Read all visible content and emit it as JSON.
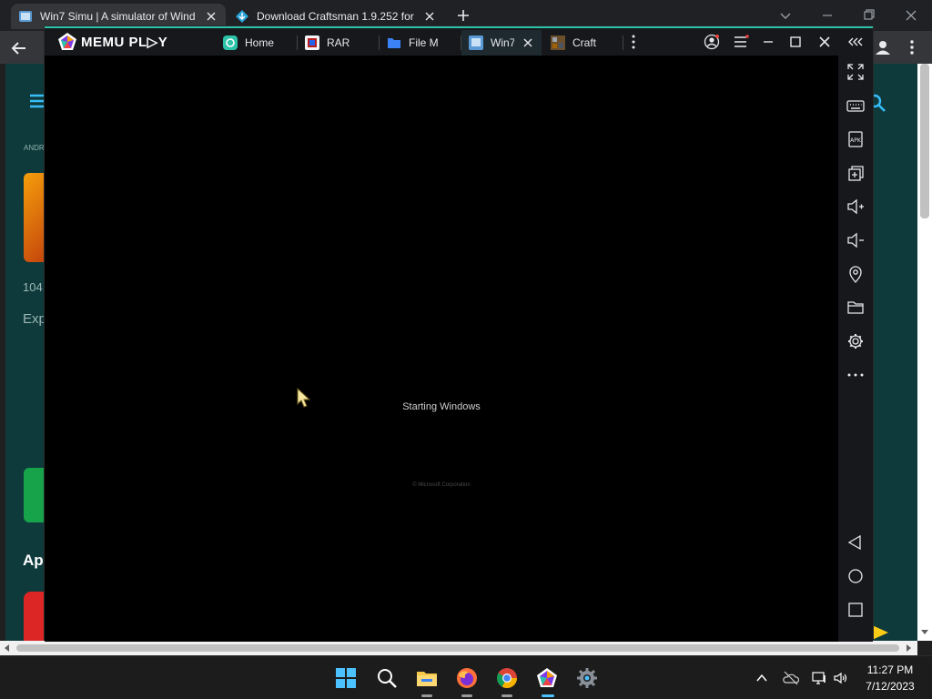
{
  "browser": {
    "tabs": [
      {
        "title": "Win7 Simu | A simulator of Wind",
        "active": true
      },
      {
        "title": "Download Craftsman 1.9.252 for",
        "active": false
      }
    ]
  },
  "website": {
    "breadcrumb": "ANDR",
    "stat": "104",
    "description": "Exp",
    "section_heading": "Ap"
  },
  "memu": {
    "logo_text": "MEMU PL▷Y",
    "tabs": [
      {
        "title": "Home",
        "active": false
      },
      {
        "title": "RAR",
        "active": false
      },
      {
        "title": "File M",
        "active": false
      },
      {
        "title": "Win7",
        "active": true
      },
      {
        "title": "Craft",
        "active": false
      }
    ],
    "boot_text": "Starting Windows",
    "copyright": "© Microsoft Corporation",
    "accent_color": "#2cc3a8"
  },
  "taskbar": {
    "time": "11:27 PM",
    "date": "7/12/2023"
  }
}
